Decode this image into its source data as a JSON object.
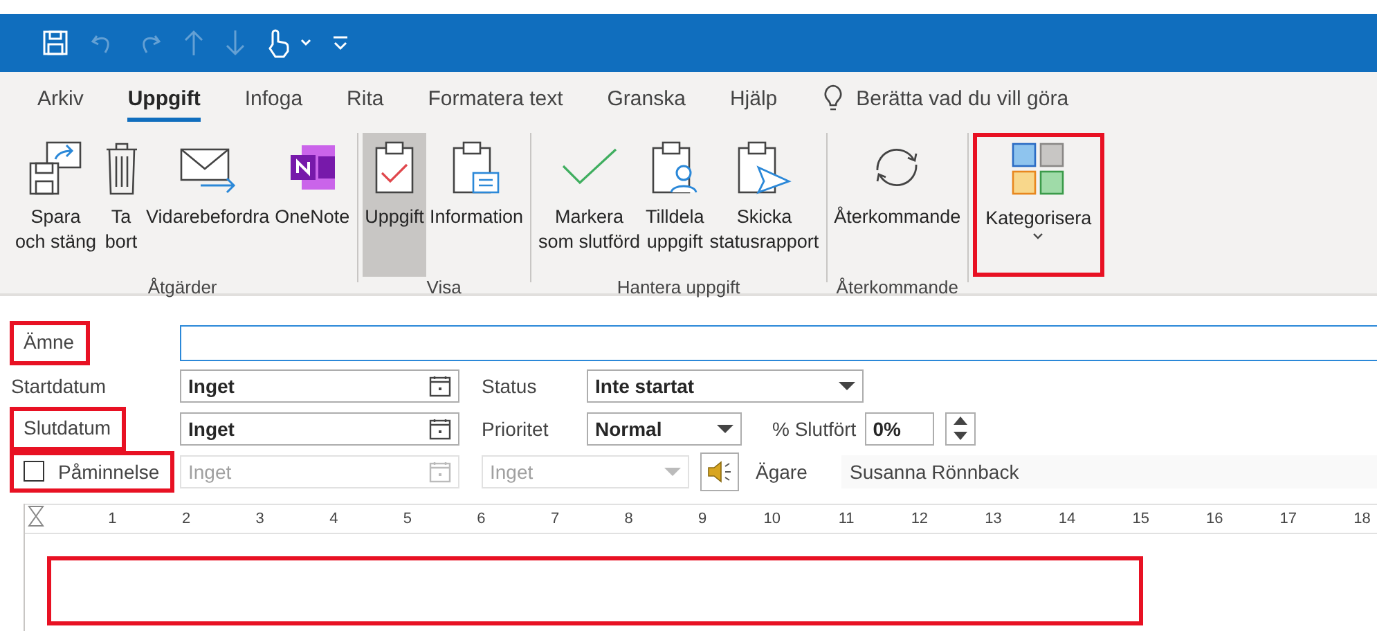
{
  "quick_access": [
    {
      "kind": "save",
      "disabled": false
    },
    {
      "kind": "undo",
      "disabled": true
    },
    {
      "kind": "redo",
      "disabled": true
    },
    {
      "kind": "up",
      "disabled": true
    },
    {
      "kind": "down",
      "disabled": true
    },
    {
      "kind": "touch",
      "disabled": false
    },
    {
      "kind": "customize",
      "disabled": false
    }
  ],
  "tabs": [
    {
      "label": "Arkiv",
      "selected": false
    },
    {
      "label": "Uppgift",
      "selected": true
    },
    {
      "label": "Infoga",
      "selected": false
    },
    {
      "label": "Rita",
      "selected": false
    },
    {
      "label": "Formatera text",
      "selected": false
    },
    {
      "label": "Granska",
      "selected": false
    },
    {
      "label": "Hjälp",
      "selected": false
    }
  ],
  "tell_me": {
    "placeholder": "Berätta vad du vill göra"
  },
  "ribbon_groups": [
    {
      "label": "Åtgärder",
      "buttons": [
        {
          "kind": "save-close",
          "label": "Spara\noch stäng",
          "selected": false,
          "highlighted": false
        },
        {
          "kind": "delete",
          "label": "Ta\nbort",
          "selected": false,
          "highlighted": false
        },
        {
          "kind": "forward",
          "label": "Vidarebefordra",
          "selected": false,
          "highlighted": false
        },
        {
          "kind": "onenote",
          "label": "OneNote",
          "selected": false,
          "highlighted": false
        }
      ]
    },
    {
      "label": "Visa",
      "buttons": [
        {
          "kind": "task",
          "label": "Uppgift",
          "selected": true,
          "highlighted": false
        },
        {
          "kind": "details",
          "label": "Information",
          "selected": false,
          "highlighted": false
        }
      ]
    },
    {
      "label": "Hantera uppgift",
      "buttons": [
        {
          "kind": "complete",
          "label": "Markera\nsom slutförd",
          "selected": false,
          "highlighted": false
        },
        {
          "kind": "assign",
          "label": "Tilldela\nuppgift",
          "selected": false,
          "highlighted": false
        },
        {
          "kind": "send",
          "label": "Skicka\nstatusrapport",
          "selected": false,
          "highlighted": false
        }
      ]
    },
    {
      "label": "Återkommande",
      "buttons": [
        {
          "kind": "recurrence",
          "label": "Återkommande",
          "selected": false,
          "highlighted": false
        }
      ]
    },
    {
      "buttons": [
        {
          "kind": "categorize",
          "label": "Kategorisera",
          "selected": false,
          "highlighted": true,
          "dropdown": true
        }
      ]
    }
  ],
  "subject": {
    "label": "Ämne",
    "highlighted": true
  },
  "start_date": {
    "label": "Startdatum",
    "value": "Inget",
    "highlighted": false
  },
  "status": {
    "label": "Status",
    "value": "Inte startat"
  },
  "due_date": {
    "label": "Slutdatum",
    "value": "Inget",
    "highlighted": true
  },
  "priority": {
    "label": "Prioritet",
    "value": "Normal"
  },
  "percent_complete": {
    "label": "% Slutfört",
    "value": "0%"
  },
  "reminder": {
    "label": "Påminnelse",
    "checked": false,
    "highlighted": true,
    "disabled": true,
    "date": "Inget",
    "time": "Inget"
  },
  "owner": {
    "label": "Ägare",
    "value": "Susanna Rönnback"
  },
  "ruler": {
    "labels": [
      "1",
      "2",
      "3",
      "4",
      "5",
      "6",
      "7",
      "8",
      "9",
      "10",
      "11",
      "12",
      "13",
      "14",
      "15",
      "16",
      "17",
      "18"
    ]
  },
  "body": {
    "highlighted": true
  }
}
